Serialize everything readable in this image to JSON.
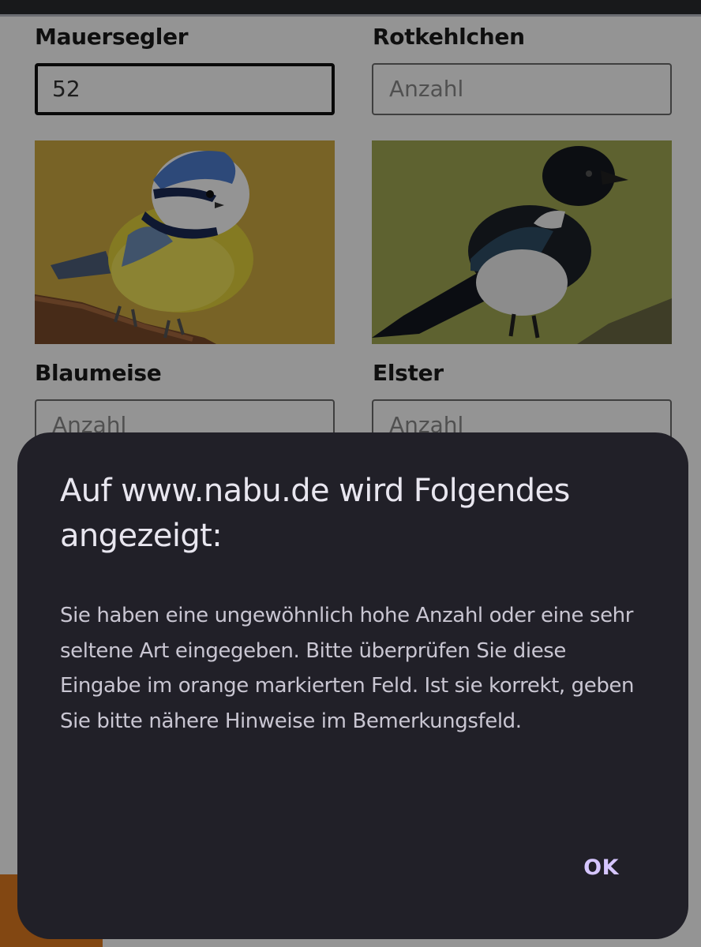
{
  "form": {
    "bird1": {
      "label": "Mauersegler",
      "value": "52",
      "placeholder": "Anzahl"
    },
    "bird2": {
      "label": "Rotkehlchen",
      "value": "",
      "placeholder": "Anzahl"
    },
    "bird3": {
      "label": "Blaumeise",
      "value": "",
      "placeholder": "Anzahl",
      "image": "blue-tit-photo"
    },
    "bird4": {
      "label": "Elster",
      "value": "",
      "placeholder": "Anzahl",
      "image": "magpie-photo"
    }
  },
  "dialog": {
    "title": "Auf www.nabu.de wird Folgendes angezeigt:",
    "message": "Sie haben eine ungewöhnlich hohe Anzahl oder eine sehr seltene Art eingegeben. Bitte überprüfen Sie diese Eingabe im orange markierten Feld. Ist sie korrekt, geben Sie bitte nähere Hinweise im Bemerkungsfeld.",
    "ok_label": "OK"
  },
  "colors": {
    "dialog_bg": "#212028",
    "ok_accent": "#d6c6ff",
    "highlight_orange": "#e07a1f"
  }
}
